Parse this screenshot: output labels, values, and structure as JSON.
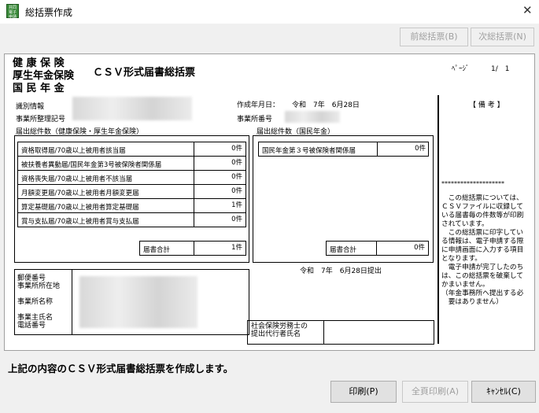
{
  "window": {
    "title": "総括票作成",
    "icon_text": "共同\n電子\n申請",
    "close_glyph": "✕"
  },
  "nav": {
    "prev_label": "前総括票(B)",
    "next_label": "次総括票(N)"
  },
  "sheet": {
    "heading_lines": [
      "健 康 保 険",
      "厚生年金保険",
      "国 民 年 金"
    ],
    "form_title": "ＣＳＶ形式届書総括票",
    "page_label": "ﾍﾟｰｼﾞ",
    "page_value": "1/　1",
    "id_label": "識別情報",
    "office_reg_label": "事業所整理記号",
    "created_date_label": "作成年月日：",
    "created_date_value": "令和　7年　6月28日",
    "office_number_label": "事業所番号",
    "remarks_label": "【 備 考 】",
    "left_section_title": "届出総件数（健康保険・厚生年金保険）",
    "left_rows": [
      {
        "label": "資格取得届/70歳以上被用者該当届",
        "value": "0件"
      },
      {
        "label": "被扶養者異動届/国民年金第3号被保険者関係届",
        "value": "0件"
      },
      {
        "label": "資格喪失届/70歳以上被用者不該当届",
        "value": "0件"
      },
      {
        "label": "月額変更届/70歳以上被用者月額変更届",
        "value": "0件"
      },
      {
        "label": "算定基礎届/70歳以上被用者算定基礎届",
        "value": "1件"
      },
      {
        "label": "賞与支払届/70歳以上被用者賞与支払届",
        "value": "0件"
      }
    ],
    "left_total_label": "届書合計",
    "left_total_value": "1件",
    "right_section_title": "届出総件数（国民年金）",
    "right_rows": [
      {
        "label": "国民年金第３号被保険者関係届",
        "value": "0件"
      }
    ],
    "right_total_label": "届書合計",
    "right_total_value": "0件",
    "submit_date": "令和　7年　6月28日提出",
    "address_labels": [
      "郵便番号",
      "事業所所在地",
      "事業所名称",
      "事業主氏名",
      "電話番号"
    ],
    "agent_label_lines": [
      "社会保険労務士の",
      "提出代行者氏名"
    ],
    "stars": "********************",
    "notes_text": "　この総括票については、\nＣＳＶファイルに収録して\nいる届書毎の件数等が印刷\nされています。\n　この総括票に印字してい\nる情報は、電子申請する際\nに申請画面に入力する項目\nとなります。\n　電子申請が完了したのち\nは、この総括票を破棄して\nかまいません。\n（年金事務所へ提出する必\n　要はありません）"
  },
  "footer": {
    "message": "上記の内容のＣＳＶ形式届書総括票を作成します。",
    "print_label": "印刷(P)",
    "print_all_label": "全頁印刷(A)",
    "cancel_label": "ｷｬﾝｾﾙ(C)"
  }
}
